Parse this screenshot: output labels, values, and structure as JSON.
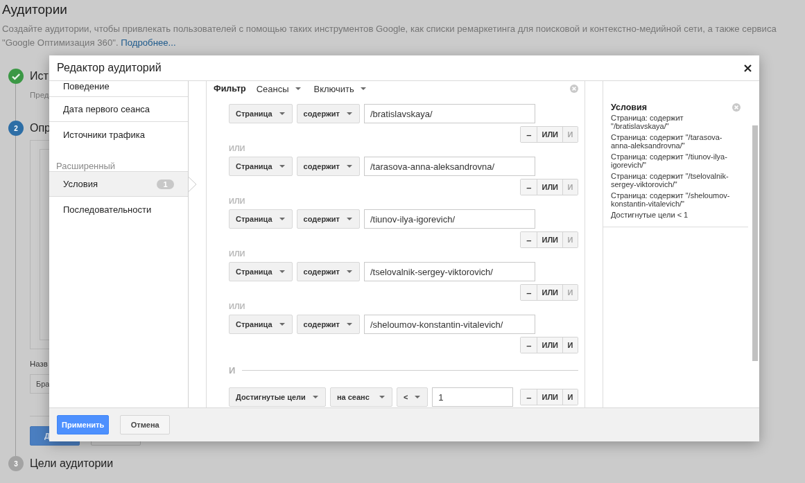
{
  "page": {
    "title": "Аудитории",
    "description": "Создайте аудитории, чтобы привлекать пользователей с помощью таких инструментов Google, как списки ремаркетинга для поисковой и контекстно-медийной сети, а также сервиса \"Google Оптимизация 360\".",
    "link": "Подробнее..."
  },
  "steps": [
    {
      "kind": "done",
      "title": "Ист",
      "subtitle": "Пред"
    },
    {
      "kind": "current",
      "number": "2",
      "title": "Опр",
      "form": {
        "name_label": "Назв",
        "name_value": "Бра",
        "buttons": [
          {
            "kind": "primary",
            "label": "Д"
          },
          {
            "kind": "secondary"
          }
        ]
      }
    },
    {
      "kind": "pending",
      "number": "3",
      "title": "Цели аудитории"
    }
  ],
  "modal": {
    "title": "Редактор аудиторий",
    "nav": [
      {
        "items": [
          {
            "label": "Поведение",
            "selected": false
          },
          {
            "label": "Дата первого сеанса",
            "selected": false
          },
          {
            "label": "Источники трафика",
            "selected": false
          }
        ]
      },
      {
        "heading": "Расширенный",
        "items": [
          {
            "label": "Условия",
            "selected": true,
            "badge": "1"
          },
          {
            "label": "Последовательности",
            "selected": false
          }
        ]
      }
    ],
    "filter": {
      "label": "Фильтр",
      "scope": "Сеансы",
      "mode": "Включить",
      "groups": [
        {
          "conditions": [
            {
              "kind": "stacked",
              "selects": [
                "Страница",
                "содержит"
              ],
              "value": "/bratislavskaya/",
              "buttons": [
                {
                  "label": "–",
                  "disabled": false
                },
                {
                  "label": "ИЛИ",
                  "disabled": false
                },
                {
                  "label": "И",
                  "disabled": true
                }
              ]
            },
            {
              "connector": "ИЛИ",
              "kind": "stacked",
              "selects": [
                "Страница",
                "содержит"
              ],
              "value": "/tarasova-anna-aleksandrovna/",
              "buttons": [
                {
                  "label": "–",
                  "disabled": false
                },
                {
                  "label": "ИЛИ",
                  "disabled": false
                },
                {
                  "label": "И",
                  "disabled": true
                }
              ]
            },
            {
              "connector": "ИЛИ",
              "kind": "stacked",
              "selects": [
                "Страница",
                "содержит"
              ],
              "value": "/tiunov-ilya-igorevich/",
              "buttons": [
                {
                  "label": "–",
                  "disabled": false
                },
                {
                  "label": "ИЛИ",
                  "disabled": false
                },
                {
                  "label": "И",
                  "disabled": true
                }
              ]
            },
            {
              "connector": "ИЛИ",
              "kind": "stacked",
              "selects": [
                "Страница",
                "содержит"
              ],
              "value": "/tselovalnik-sergey-viktorovich/",
              "buttons": [
                {
                  "label": "–",
                  "disabled": false
                },
                {
                  "label": "ИЛИ",
                  "disabled": false
                },
                {
                  "label": "И",
                  "disabled": true
                }
              ]
            },
            {
              "connector": "ИЛИ",
              "kind": "stacked",
              "selects": [
                "Страница",
                "содержит"
              ],
              "value": "/sheloumov-konstantin-vitalevich/",
              "buttons": [
                {
                  "label": "–",
                  "disabled": false
                },
                {
                  "label": "ИЛИ",
                  "disabled": false
                },
                {
                  "label": "И",
                  "disabled": false
                }
              ]
            }
          ]
        },
        {
          "connector": "И",
          "conditions": [
            {
              "kind": "inline",
              "selects": [
                "Достигнутые цели",
                "на сеанс",
                "<"
              ],
              "value": "1",
              "buttons": [
                {
                  "label": "–",
                  "disabled": false
                },
                {
                  "label": "ИЛИ",
                  "disabled": false
                },
                {
                  "label": "И",
                  "disabled": false
                }
              ]
            }
          ]
        }
      ]
    },
    "summary": {
      "title": "Условия",
      "lines": [
        "Страница: содержит \"/bratislavskaya/\"",
        "Страница: содержит \"/tarasova-anna-aleksandrovna/\"",
        "Страница: содержит \"/tiunov-ilya-igorevich/\"",
        "Страница: содержит \"/tselovalnik-sergey-viktorovich/\"",
        "Страница: содержит \"/sheloumov-konstantin-vitalevich/\"",
        "Достигнутые цели < 1"
      ]
    },
    "buttons": [
      {
        "kind": "primary",
        "label": "Применить"
      },
      {
        "kind": "default",
        "label": "Отмена"
      }
    ]
  }
}
